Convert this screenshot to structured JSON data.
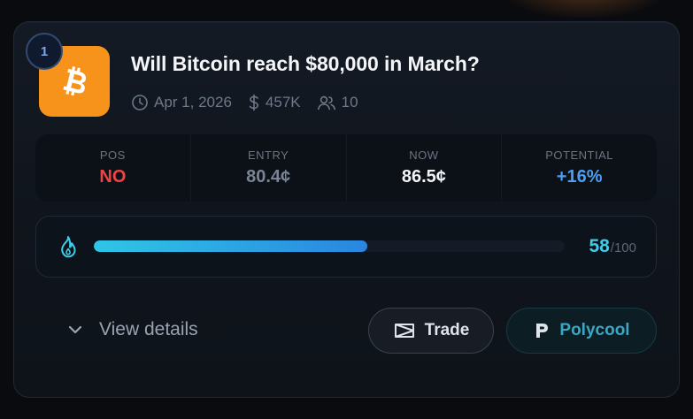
{
  "market": {
    "rank": "1",
    "title": "Will Bitcoin reach $80,000 in March?",
    "coin_icon": "bitcoin-icon",
    "date": "Apr 1, 2026",
    "volume": "457K",
    "traders": "10"
  },
  "stats": [
    {
      "label": "POS",
      "value": "NO",
      "color": "#ef4444"
    },
    {
      "label": "ENTRY",
      "value": "80.4¢",
      "color": "#7b8494"
    },
    {
      "label": "NOW",
      "value": "86.5¢",
      "color": "#f2f4f7"
    },
    {
      "label": "POTENTIAL",
      "value": "+16%",
      "color": "#4d9ef2"
    }
  ],
  "score": {
    "value": "58",
    "max": "/100",
    "fraction": 0.58,
    "icon": "flame-icon",
    "color": "#3dcde9"
  },
  "actions": {
    "details_label": "View details",
    "trade_label": "Trade",
    "poly_label": "Polycool"
  },
  "colors": {
    "accent_orange": "#f7931a",
    "cyan": "#3dcde9",
    "red": "#ef4444",
    "blue": "#4d9ef2"
  }
}
